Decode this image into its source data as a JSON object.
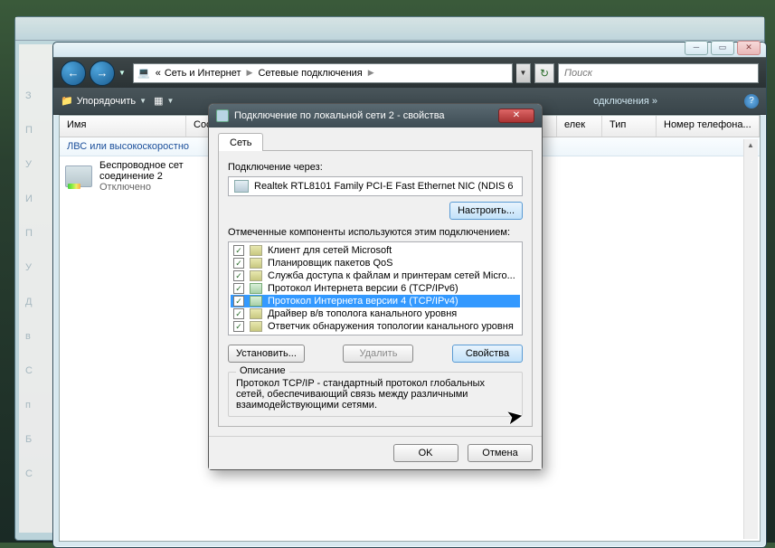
{
  "explorer": {
    "breadcrumbs": [
      "Сеть и Интернет",
      "Сетевые подключения"
    ],
    "search_placeholder": "Поиск",
    "toolbar": {
      "organize": "Упорядочить",
      "views": "",
      "center_label": "одключения",
      "more": "»"
    },
    "columns": {
      "name": "Имя",
      "status": "Состояние",
      "device": "елек",
      "type": "Тип",
      "phone": "Номер телефона..."
    },
    "group_header": "ЛВС или высокоскоростно",
    "item": {
      "line1": "Беспроводное сет",
      "line2": "соединение 2",
      "line3": "Отключено"
    }
  },
  "dialog": {
    "title": "Подключение по локальной сети 2 - свойства",
    "tab": "Сеть",
    "connect_via_label": "Подключение через:",
    "adapter": "Realtek RTL8101 Family PCI-E Fast Ethernet NIC (NDIS 6",
    "configure_btn": "Настроить...",
    "components_label": "Отмеченные компоненты используются этим подключением:",
    "components": [
      {
        "checked": true,
        "label": "Клиент для сетей Microsoft",
        "selected": false
      },
      {
        "checked": true,
        "label": "Планировщик пакетов QoS",
        "selected": false
      },
      {
        "checked": true,
        "label": "Служба доступа к файлам и принтерам сетей Micro...",
        "selected": false
      },
      {
        "checked": true,
        "label": "Протокол Интернета версии 6 (TCP/IPv6)",
        "selected": false
      },
      {
        "checked": true,
        "label": "Протокол Интернета версии 4 (TCP/IPv4)",
        "selected": true
      },
      {
        "checked": true,
        "label": "Драйвер в/в тополога канального уровня",
        "selected": false
      },
      {
        "checked": true,
        "label": "Ответчик обнаружения топологии канального уровня",
        "selected": false
      }
    ],
    "install_btn": "Установить...",
    "remove_btn": "Удалить",
    "properties_btn": "Свойства",
    "desc_legend": "Описание",
    "desc_text": "Протокол TCP/IP - стандартный протокол глобальных сетей, обеспечивающий связь между различными взаимодействующими сетями.",
    "ok_btn": "OK",
    "cancel_btn": "Отмена"
  },
  "left_edge_letters": [
    "З",
    "П",
    "У",
    "И",
    "П",
    "У",
    "Д",
    "в",
    "С",
    "п",
    "Б",
    "С"
  ]
}
